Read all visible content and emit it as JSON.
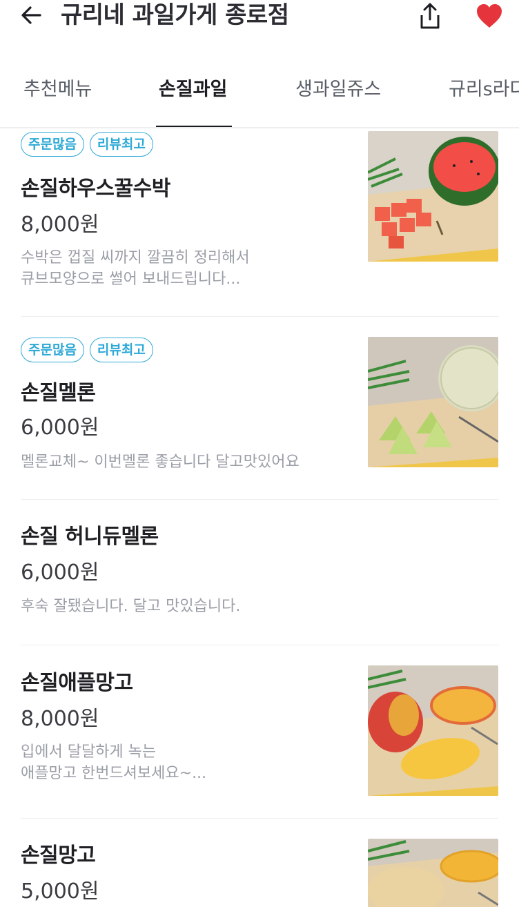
{
  "header": {
    "title": "규리네 과일가게 종로점",
    "back_icon": "arrow-left-icon",
    "share_icon": "share-icon",
    "favorite_icon": "heart-icon",
    "favorite_color": "#e5343b"
  },
  "tabs": [
    {
      "label": "추천메뉴"
    },
    {
      "label": "손질과일"
    },
    {
      "label": "생과일쥬스"
    },
    {
      "label": "규리s라다"
    }
  ],
  "active_tab": "손질과일",
  "accent_color": "#2ea9d6",
  "menu": [
    {
      "badges": [
        "주문많음",
        "리뷰최고"
      ],
      "name": "손질하우스꿀수박",
      "price": "8,000원",
      "desc_lines": [
        "수박은 껍질 씨까지 깔끔히 정리해서",
        "큐브모양으로 썰어 보내드립니다..."
      ],
      "image": "watermelon-photo"
    },
    {
      "badges": [
        "주문많음",
        "리뷰최고"
      ],
      "name": "손질멜론",
      "price": "6,000원",
      "desc_lines": [
        "멜론교체~ 이번멜론 좋습니다 달고맛있어요"
      ],
      "image": "melon-photo"
    },
    {
      "name": "손질 허니듀멜론",
      "price": "6,000원",
      "desc_lines": [
        "후숙 잘됐습니다. 달고 맛있습니다."
      ]
    },
    {
      "name": "손질애플망고",
      "price": "8,000원",
      "desc_lines": [
        "입에서 달달하게 녹는",
        "애플망고 한번드셔보세요~..."
      ],
      "image": "apple-mango-photo"
    },
    {
      "name": "손질망고",
      "price": "5,000원",
      "image": "mango-photo"
    }
  ]
}
